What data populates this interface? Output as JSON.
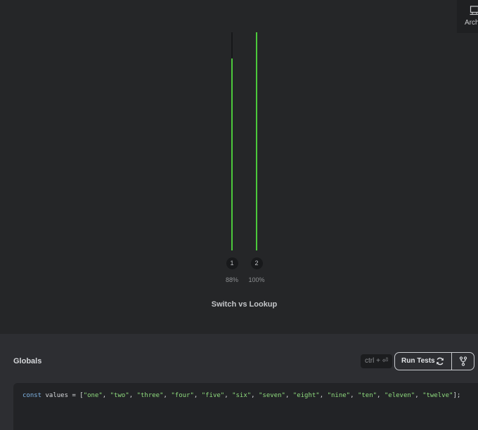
{
  "header": {
    "archive_label": "Archive",
    "archive_icon": "archive-icon"
  },
  "chart_data": {
    "type": "bar",
    "title": "Switch vs Lookup",
    "categories": [
      "1",
      "2"
    ],
    "values": [
      88,
      100
    ],
    "value_labels": [
      "88%",
      "100%"
    ],
    "ylim": [
      0,
      100
    ],
    "bar_color": "#4cc93b",
    "track_color": "#17181a"
  },
  "globals": {
    "title": "Globals",
    "shortcut": "ctrl + ⏎",
    "run_label": "Run Tests",
    "run_icon": "refresh-icon",
    "fork_icon": "fork-icon",
    "code": {
      "keyword": "const",
      "name": "values",
      "operator": "=",
      "items": [
        "one",
        "two",
        "three",
        "four",
        "five",
        "six",
        "seven",
        "eight",
        "nine",
        "ten",
        "eleven",
        "twelve"
      ]
    }
  },
  "colors": {
    "keyword": "#7fb5e6",
    "string": "#8fdc7e",
    "text": "#d7d9dc"
  }
}
